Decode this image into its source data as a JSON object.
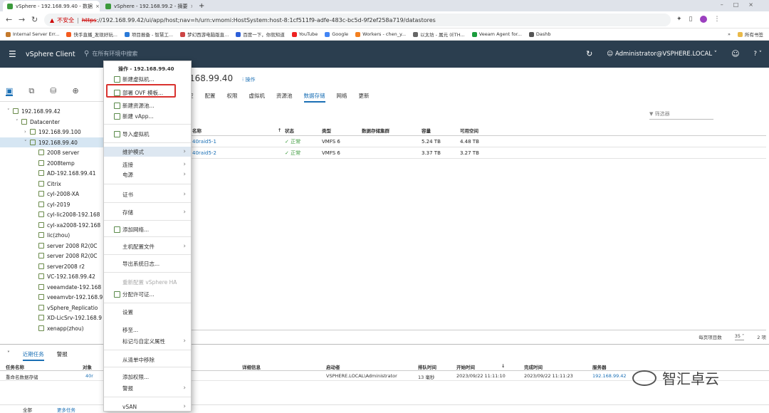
{
  "browser": {
    "tabs": [
      {
        "label": "vSphere - 192.168.99.40 - 数据",
        "close": "×"
      },
      {
        "label": "vSphere - 192.168.99.2 - 摘要",
        "close": "×"
      }
    ],
    "new_tab": "+",
    "url": {
      "warning": "不安全",
      "scheme": "https",
      "host_path": "://192.168.99.42/ui/app/host;nav=h/urn:vmomi:HostSystem:host-8:1cf511f9-adfe-483c-bc5d-9f2ef258a719/datastores"
    },
    "bookmarks": [
      {
        "label": "Internal Server Err...",
        "color": "#c47a2c"
      },
      {
        "label": "快手直播_发现好玩...",
        "color": "#f45a1e"
      },
      {
        "label": "项目报备 - 智慧工...",
        "color": "#2a7ad8"
      },
      {
        "label": "梦幻西游电脑版直...",
        "color": "#c44"
      },
      {
        "label": "百度一下，你就知道",
        "color": "#2d5fd8"
      },
      {
        "label": "YouTube",
        "color": "#e22"
      },
      {
        "label": "Google",
        "color": "#4285f4"
      },
      {
        "label": "Workers - chen_y...",
        "color": "#f38020"
      },
      {
        "label": "以太坊 - 属元 (ETH...",
        "color": "#666"
      },
      {
        "label": "Veeam Agent for...",
        "color": "#1a9c3c"
      },
      {
        "label": "Dashb",
        "color": "#555"
      }
    ],
    "bookmarks_more": "»",
    "bookmarks_all": "所有书签",
    "find": {
      "up": "˄",
      "down": "˅",
      "close": "×"
    }
  },
  "header": {
    "app_title": "vSphere Client",
    "search_placeholder": "在所有环境中搜索",
    "user": "Administrator@VSPHERE.LOCAL ˅",
    "help": "? ˅"
  },
  "tree": [
    {
      "label": "192.168.99.42",
      "indent": 0,
      "caret": "˅"
    },
    {
      "label": "Datacenter",
      "indent": 1,
      "caret": "˅"
    },
    {
      "label": "192.168.99.100",
      "indent": 2,
      "caret": "›"
    },
    {
      "label": "192.168.99.40",
      "indent": 2,
      "caret": "˅",
      "selected": true
    },
    {
      "label": "2008 server",
      "indent": 3
    },
    {
      "label": "2008temp",
      "indent": 3
    },
    {
      "label": "AD-192.168.99.41",
      "indent": 3
    },
    {
      "label": "Citrix",
      "indent": 3
    },
    {
      "label": "cyl-2008-XA",
      "indent": 3
    },
    {
      "label": "cyl-2019",
      "indent": 3
    },
    {
      "label": "cyl-lic2008-192.168",
      "indent": 3
    },
    {
      "label": "cyl-xa2008-192.168",
      "indent": 3
    },
    {
      "label": "lic(zhou)",
      "indent": 3
    },
    {
      "label": "server 2008 R2(0C",
      "indent": 3
    },
    {
      "label": "server 2008 R2(0C",
      "indent": 3
    },
    {
      "label": "server2008 r2",
      "indent": 3
    },
    {
      "label": "VC-192.168.99.42",
      "indent": 3
    },
    {
      "label": "veeamdate-192.168",
      "indent": 3
    },
    {
      "label": "veeamvbr-192.168.9",
      "indent": 3
    },
    {
      "label": "vSphere_Replicatio",
      "indent": 3
    },
    {
      "label": "XD-LicSrv-192.168.9",
      "indent": 3
    },
    {
      "label": "xenapp(zhou)",
      "indent": 3
    }
  ],
  "main": {
    "host_title": "168.99.40",
    "actions_link": "⁝ 操作",
    "tabs": [
      "控",
      "配置",
      "权限",
      "虚拟机",
      "资源池",
      "数据存储",
      "网络",
      "更新"
    ],
    "active_tab": "数据存储",
    "filter_placeholder": "▼ 筛选器",
    "columns": [
      "名称",
      "↑",
      "状态",
      "类型",
      "数据存储集群",
      "容量",
      "可用空间"
    ],
    "rows": [
      {
        "name": "40raid5-1",
        "status": "✓ 正常",
        "type": "VMFS 6",
        "cluster": "",
        "capacity": "5.24 TB",
        "free": "4.48 TB"
      },
      {
        "name": "40raid5-2",
        "status": "✓ 正常",
        "type": "VMFS 6",
        "cluster": "",
        "capacity": "3.37 TB",
        "free": "3.27 TB"
      }
    ],
    "per_page_label": "每页项目数",
    "per_page_value": "35 ˅",
    "total": "2 项"
  },
  "context_menu": {
    "header": "操作 - 192.168.99.40",
    "items": [
      {
        "label": "新建虚拟机...",
        "icon": true
      },
      {
        "label": "部署 OVF 模板...",
        "icon": true,
        "highlight_box": true
      },
      {
        "label": "新建资源池...",
        "icon": true
      },
      {
        "label": "新建 vApp...",
        "icon": true
      },
      {
        "label": "导入虚拟机",
        "icon": true
      },
      {
        "label": "维护模式",
        "submenu": true,
        "hover": true
      },
      {
        "label": "连接",
        "submenu": true
      },
      {
        "label": "电源",
        "submenu": true
      },
      {
        "label": "证书",
        "submenu": true
      },
      {
        "label": "存储",
        "submenu": true
      },
      {
        "label": "添加网络...",
        "icon": true
      },
      {
        "label": "主机配置文件",
        "submenu": true
      },
      {
        "label": "导出系统日志..."
      },
      {
        "label": "重新配置 vSphere HA",
        "disabled": true
      },
      {
        "label": "分配许可证...",
        "icon": true
      },
      {
        "label": "设置"
      },
      {
        "label": "移至..."
      },
      {
        "label": "标记与自定义属性",
        "submenu": true
      },
      {
        "label": "从清单中移除"
      },
      {
        "label": "添加权限..."
      },
      {
        "label": "警报",
        "submenu": true
      },
      {
        "label": "vSAN",
        "submenu": true
      }
    ],
    "submenu_arrow": "›"
  },
  "tasks": {
    "tabs": [
      "近期任务",
      "警报"
    ],
    "active": "近期任务",
    "collapse": "˅",
    "columns": [
      "任务名称",
      "对象",
      "详细信息",
      "启动者",
      "排队时间",
      "开始时间",
      "↓",
      "完成时间",
      "服务器"
    ],
    "row": {
      "name": "重命名数据存储",
      "object": "40r",
      "initiator": "VSPHERE.LOCAL\\Administrator",
      "queued": "13 毫秒",
      "start": "2023/09/22 11:11:10",
      "end": "2023/09/22 11:11:23",
      "server": "192.168.99.42"
    },
    "footer_all": "全部",
    "footer_more": "更多任务"
  },
  "watermark": "智汇卓云"
}
